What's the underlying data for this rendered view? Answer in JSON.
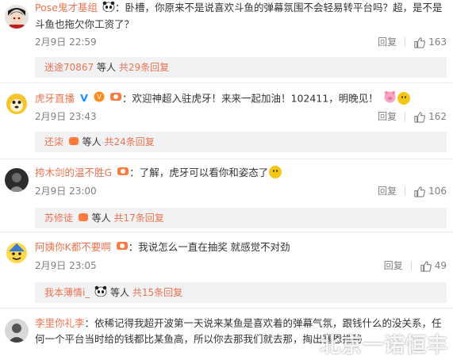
{
  "comments": [
    {
      "user": "Pose鬼才基组",
      "separator": "：",
      "text": "卧槽，你原来不是说喜欢斗鱼的弹幕氛围不会轻易转平台吗？超，是不是斗鱼也拖欠你工资了？",
      "time": "2月9日 22:59",
      "reply_label": "回复",
      "likes": "163",
      "subreplies": {
        "user": "迷途70867",
        "others": "等人",
        "count": "共29条回复"
      }
    },
    {
      "user": "虎牙直播",
      "separator": "：",
      "text": "欢迎神超入驻虎牙！来来一起加油！102411，明晚见！",
      "time": "2月9日 23:43",
      "reply_label": "回复",
      "likes": "162",
      "subreplies": {
        "user": "还柒",
        "others": "等人",
        "count": "共24条回复"
      }
    },
    {
      "user": "挎木剑的温不胜G",
      "separator": "：",
      "text": "了解，虎牙可以看你和姿态了",
      "time": "2月9日 23:00",
      "reply_label": "回复",
      "likes": "106",
      "subreplies": {
        "user": "苏修徒",
        "others": "等人",
        "count": "共17条回复"
      }
    },
    {
      "user": "阿姨你K都不要啊",
      "separator": "：",
      "text": "我说怎么一直在抽奖  就感觉不对劲",
      "time": "2月9日 23:05",
      "reply_label": "回复",
      "likes": "49",
      "subreplies": {
        "user": "我本薄情i_",
        "others": "等人",
        "count": "共15条回复"
      }
    },
    {
      "user": "李里你礼李",
      "separator": "：",
      "text": "依稀记得我超开波第一天说来某鱼是喜欢着的弹幕气氛，跟钱什么的没关系，任何一个平台当时给的钱都比某鱼高，所以你去那我们就去那，掏出塞恩推秘"
    }
  ],
  "watermark": "北京一诺恒丰",
  "colors": {
    "username": "#eb7350",
    "meta": "#808080",
    "subreply_bg": "#f2f2f5"
  },
  "icons": {
    "like": "thumbs-up-icon"
  }
}
